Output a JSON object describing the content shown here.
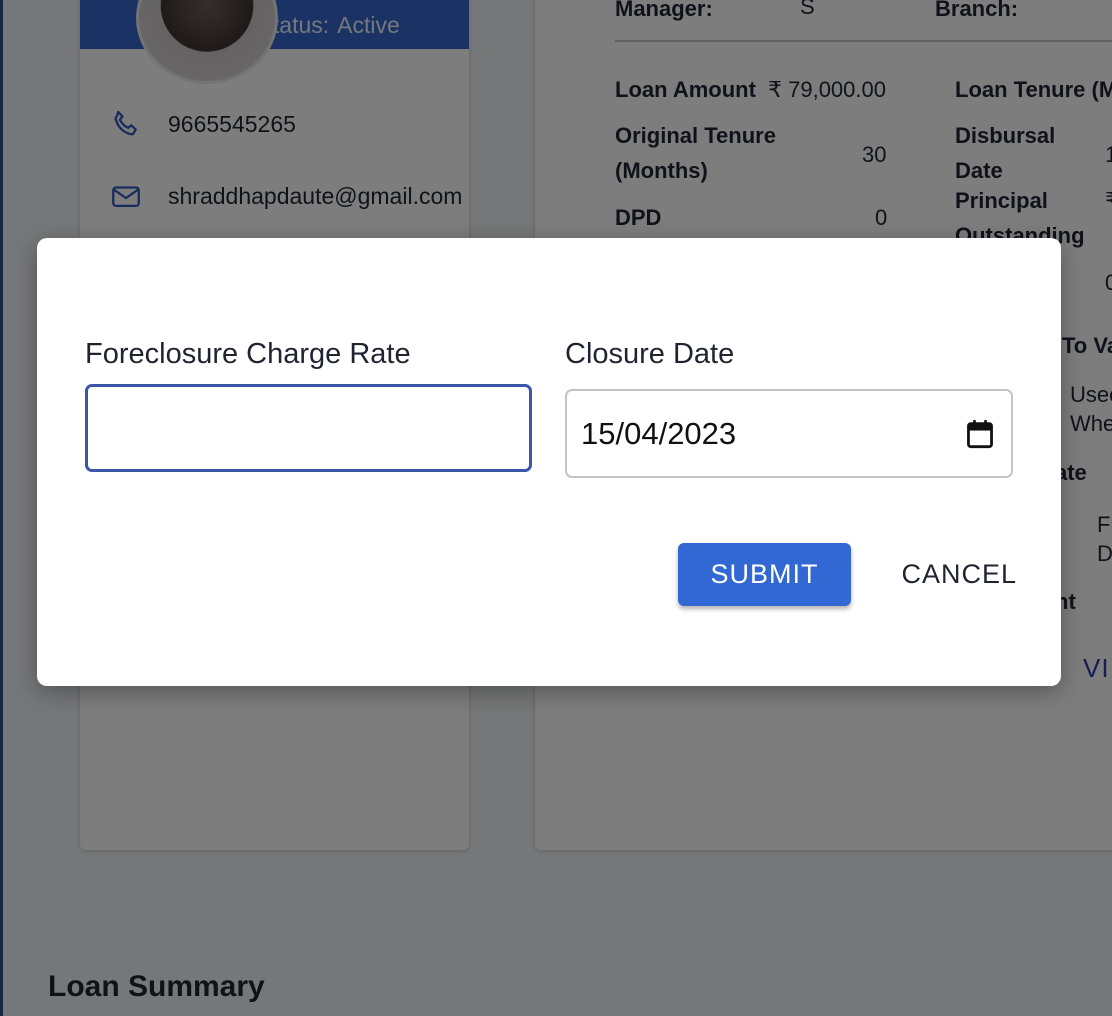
{
  "profile": {
    "loan_status_label": "Loan Status:",
    "loan_status_value": "Active",
    "phone": "9665545265",
    "email": "shraddhapdaute@gmail.com"
  },
  "details": {
    "manager_label": "Manager:",
    "manager_value": "S",
    "branch_label": "Branch:",
    "loan_amount_label": "Loan Amount",
    "loan_amount_value": "₹ 79,000.00",
    "loan_tenure_label": "Loan Tenure (M",
    "original_tenure_label_line1": "Original Tenure",
    "original_tenure_label_line2": "(Months)",
    "original_tenure_value": "30",
    "disbursal_label_line1": "Disbursal",
    "disbursal_label_line2": "Date",
    "disbursal_value": "1",
    "dpd_label": "DPD",
    "dpd_value": "0",
    "principal_label_line1": "Principal",
    "principal_label_line2": "Outstanding",
    "principal_label_line3": "nt",
    "principal_value": "₹",
    "principal_value2": "0",
    "partial_to_va": "To Va",
    "partial_usec": "Usec",
    "partial_whe": "Whe",
    "partial_ate": "ate",
    "partial_fu": "Fu",
    "partial_d": "D",
    "partial_nt": "nt",
    "view_link": "VI"
  },
  "summary": {
    "title": "Loan Summary"
  },
  "dialog": {
    "rate_label": "Foreclosure Charge Rate",
    "rate_value": "",
    "rate_placeholder": "",
    "date_label": "Closure Date",
    "date_value": "15/04/2023",
    "submit_label": "SUBMIT",
    "cancel_label": "CANCEL"
  },
  "colors": {
    "accent": "#3268d3",
    "status_bar": "#3567c9",
    "link": "#2b3fa8",
    "input_focus_border": "#3c55a8"
  },
  "icons": {
    "phone": "phone-icon",
    "email": "mail-icon",
    "calendar": "calendar-icon"
  }
}
